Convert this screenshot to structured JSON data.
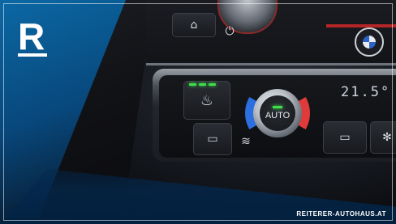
{
  "brand": {
    "logo_letter": "R",
    "url": "REITERER-AUTOHAUS.AT",
    "accent_color": "#0a6eaf"
  },
  "car_logo": {
    "icon": "bmw-roundel-icon",
    "text": "BMW"
  },
  "climate": {
    "knob_label": "AUTO",
    "temperature": "21.5°",
    "seat_heat_level": 3,
    "seat_heat_max": 3
  },
  "buttons": [
    {
      "name": "seat-heat-button",
      "icon": "seat-heat-icon"
    },
    {
      "name": "rear-defrost-button",
      "icon": "rear-defrost-icon"
    },
    {
      "name": "heat-waves-button",
      "icon": "heat-waves-icon"
    },
    {
      "name": "front-defrost-button",
      "icon": "front-defrost-icon"
    },
    {
      "name": "power-button",
      "icon": "power-icon"
    },
    {
      "name": "parking-button",
      "icon": "parking-sensor-icon"
    }
  ]
}
